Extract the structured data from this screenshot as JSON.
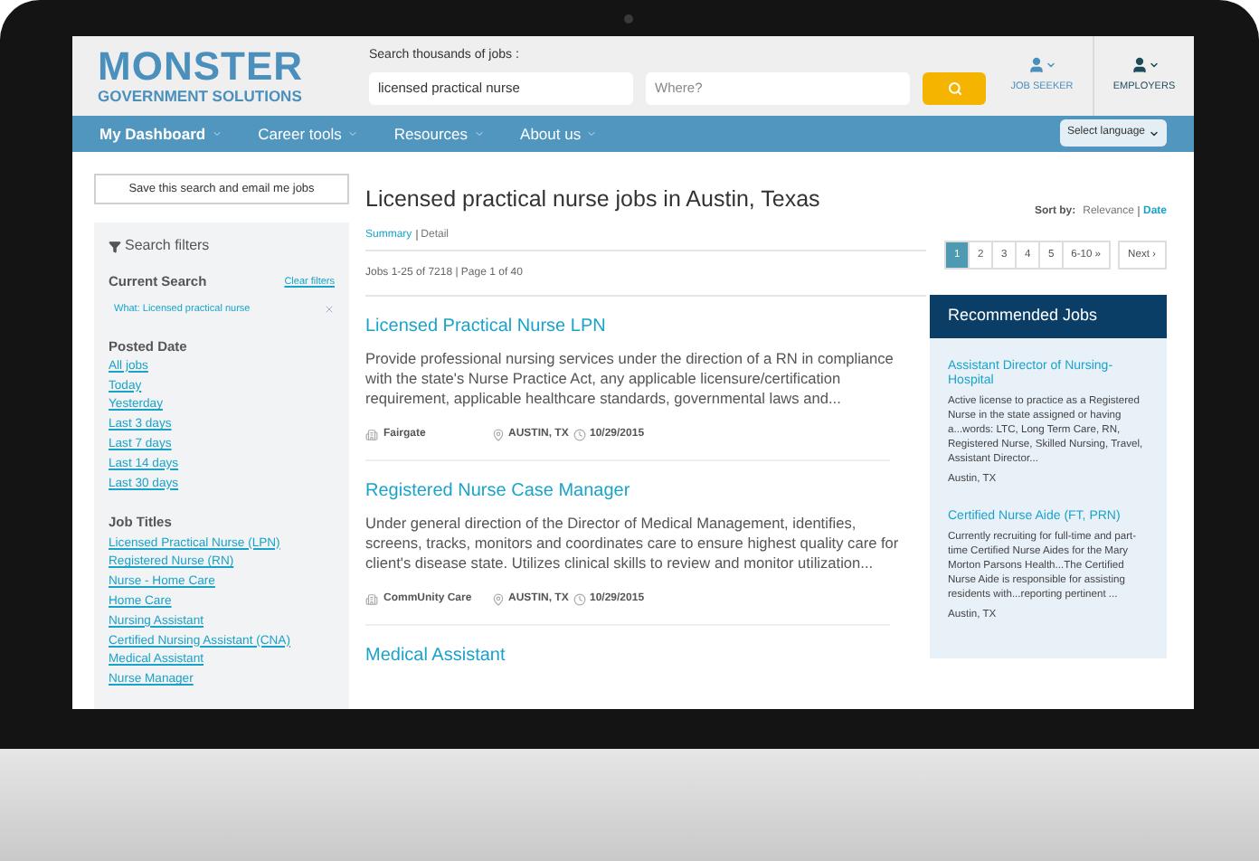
{
  "header": {
    "logo_title": "MONSTER",
    "logo_subtitle": "GOVERNMENT SOLUTIONS",
    "search_label": "Search thousands of jobs :",
    "keyword_value": "licensed practical nurse",
    "where_placeholder": "Where?",
    "user_links": [
      {
        "label": "JOB SEEKER"
      },
      {
        "label": "EMPLOYERS"
      }
    ]
  },
  "nav": {
    "items": [
      {
        "label": "My Dashboard",
        "selected": true
      },
      {
        "label": "Career tools",
        "selected": false
      },
      {
        "label": "Resources",
        "selected": false
      },
      {
        "label": "About us",
        "selected": false
      }
    ],
    "language": "Select language"
  },
  "sidebar": {
    "save_button": "Save this search and email me jobs",
    "filters_title": "Search filters",
    "current_search": {
      "title": "Current Search",
      "clear": "Clear filters",
      "tag": "What: Licensed practical nurse"
    },
    "sections": [
      {
        "title": "Posted Date",
        "links": [
          "All jobs",
          "Today",
          "Yesterday",
          "Last 3 days",
          "Last 7 days",
          "Last 14 days",
          "Last 30 days"
        ]
      },
      {
        "title": "Job Titles",
        "links": [
          "Licensed Practical Nurse (LPN)",
          "Registered Nurse (RN)",
          "Nurse - Home Care",
          "Home Care",
          "Nursing Assistant",
          "Certified Nursing Assistant (CNA)",
          "Medical Assistant",
          "Nurse Manager"
        ]
      }
    ]
  },
  "results": {
    "title": "Licensed practical nurse jobs in Austin, Texas",
    "view_tabs": [
      {
        "label": "Summary",
        "selected": true
      },
      {
        "label": "Detail",
        "selected": false
      }
    ],
    "sort_label": "Sort by:",
    "sort_options": [
      {
        "label": "Relevance",
        "selected": false
      },
      {
        "label": "Date",
        "selected": true
      }
    ],
    "count": "Jobs 1-25 of 7218 | Page 1 of 40",
    "pages": [
      {
        "label": "1",
        "selected": true
      },
      {
        "label": "2",
        "selected": false
      },
      {
        "label": "3",
        "selected": false
      },
      {
        "label": "4",
        "selected": false
      },
      {
        "label": "5",
        "selected": false
      },
      {
        "label": "6-10 »",
        "selected": false
      },
      {
        "label": "Next ›",
        "selected": false
      }
    ],
    "jobs": [
      {
        "title": "Licensed Practical Nurse LPN",
        "description": "Provide professional nursing services under the direction of a RN in compliance with the state's Nurse Practice Act, any applicable licensure/certification requirement, applicable healthcare standards, governmental laws and...",
        "company": "Fairgate",
        "location": "AUSTIN, TX",
        "date": "10/29/2015"
      },
      {
        "title": "Registered Nurse Case Manager",
        "description": "Under general direction of the Director of Medical Management, identifies, screens, tracks, monitors and coordinates care to ensure highest quality care for client's disease state. Utilizes clinical skills to review and monitor utilization...",
        "company": "CommUnity Care",
        "location": "AUSTIN, TX",
        "date": "10/29/2015"
      },
      {
        "title": "Medical Assistant"
      }
    ]
  },
  "recommended": {
    "title": "Recommended Jobs",
    "jobs": [
      {
        "title": "Assistant Director of Nursing-Hospital",
        "description": "Active license to practice as a Registered Nurse in the state assigned or having a...words: LTC, Long Term Care, RN, Registered Nurse, Skilled Nursing, Travel, Assistant Director...",
        "location": "Austin, TX"
      },
      {
        "title": "Certified Nurse Aide (FT, PRN)",
        "description": "Currently recruiting for full-time and part-time Certified Nurse Aides for the Mary Morton Parsons Health...The Certified Nurse Aide is responsible for assisting residents with...reporting pertinent ...",
        "location": "Austin, TX"
      }
    ]
  }
}
